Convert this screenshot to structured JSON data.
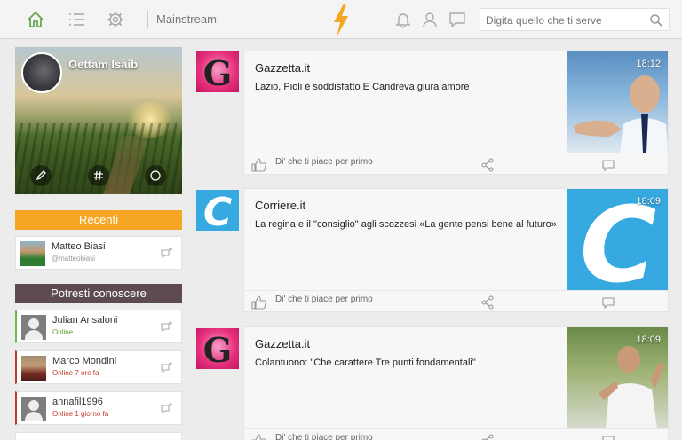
{
  "topbar": {
    "icons": [
      "home-icon",
      "list-icon",
      "gear-icon"
    ],
    "breadcrumb": "Mainstream",
    "right_icons": [
      "bell-icon",
      "user-icon",
      "chat-icon"
    ],
    "search_placeholder": "Digita quello che ti serve"
  },
  "profile": {
    "name": "Oettam Isaib",
    "actions": [
      "pencil-icon",
      "hashtag-plus-icon",
      "circle-icon"
    ]
  },
  "recenti": {
    "label": "Recenti",
    "items": [
      {
        "name": "Matteo Biasi",
        "status": "@matteobiasi"
      }
    ]
  },
  "potresti": {
    "label": "Potresti conoscere",
    "items": [
      {
        "name": "Julian Ansaloni",
        "status": "Online"
      },
      {
        "name": "Marco Mondini",
        "status": "Online 7 ore fa"
      },
      {
        "name": "annafil1996",
        "status": "Online 1 giorno fa"
      }
    ]
  },
  "feed": [
    {
      "source": "Gazzetta.it",
      "title": "Lazio, Pioli è soddisfatto E Candreva giura amore",
      "time": "18:12",
      "like_text": "Di' che ti piace per primo"
    },
    {
      "source": "Corriere.it",
      "title": "La regina e il \"consiglio\" agli scozzesi «La gente pensi bene al futuro»",
      "time": "18:09",
      "like_text": "Di' che ti piace per primo"
    },
    {
      "source": "Gazzetta.it",
      "title": "Colantuono: \"Che carattere Tre punti fondamentali\"",
      "time": "18:09",
      "like_text": "Di' che ti piace per primo"
    }
  ],
  "colors": {
    "accent_orange": "#f5a623",
    "section_dark": "#5e4b4f",
    "online_green": "#6dbd45",
    "offline_red": "#c0392b",
    "gazzetta_pink": "#e8337e",
    "corriere_blue": "#36a9e1"
  }
}
